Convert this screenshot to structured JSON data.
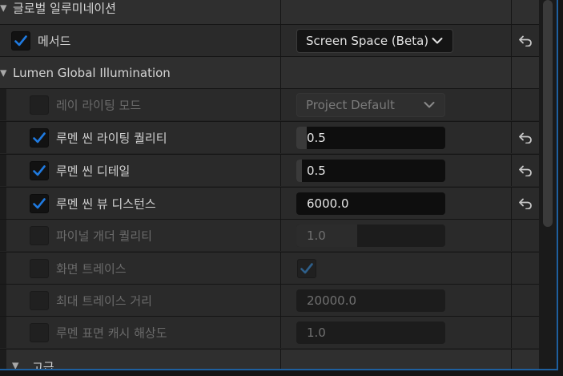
{
  "sections": {
    "global_illumination": "글로벌 일루미네이션",
    "lumen_gi": "Lumen Global Illumination",
    "advanced": "고급"
  },
  "method": {
    "label": "메서드",
    "value": "Screen Space (Beta)"
  },
  "lumen_rows": [
    {
      "label": "레이 라이팅 모드",
      "value": "Project Default"
    },
    {
      "label": "루멘 씬 라이팅 퀄리티",
      "value": "0.5",
      "fill_fraction": 0.07
    },
    {
      "label": "루멘 씬 디테일",
      "value": "0.5",
      "fill_fraction": 0.04
    },
    {
      "label": "루멘 씬 뷰 디스턴스",
      "value": "6000.0"
    },
    {
      "label": "파이널 개더 퀄리티",
      "value": "1.0",
      "fill_fraction": 0.41
    },
    {
      "label": "화면 트레이스"
    },
    {
      "label": "최대 트레이스 거리",
      "value": "20000.0"
    },
    {
      "label": "루멘 표면 캐시 해상도",
      "value": "1.0"
    }
  ],
  "colors": {
    "accent": "#1e5f9e",
    "check": "#1f7ae0",
    "check_disabled": "#2e5f8a"
  }
}
